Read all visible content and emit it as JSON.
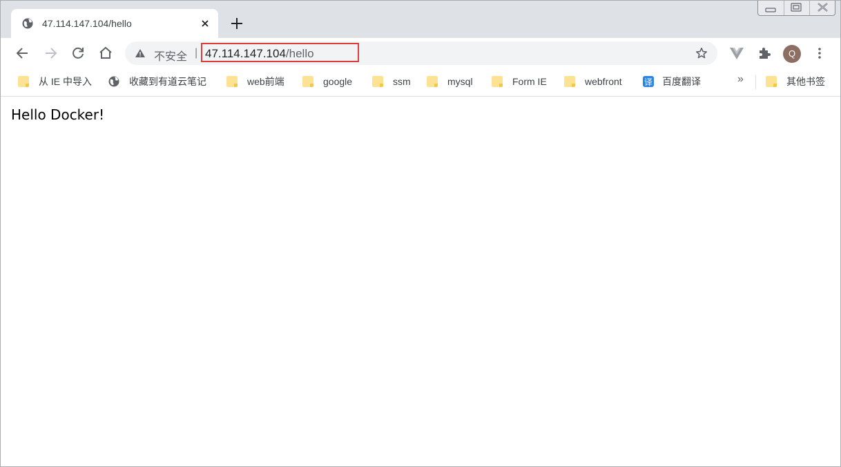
{
  "tab": {
    "title": "47.114.147.104/hello",
    "favicon_icon": "globe-icon"
  },
  "omnibox": {
    "security_label": "不安全",
    "separator": "|",
    "url_host": "47.114.147.104",
    "url_path": "/hello"
  },
  "avatar": {
    "initial": "Q"
  },
  "bookmarks": {
    "items": [
      {
        "label": "从 IE 中导入",
        "icon": "folder-icon"
      },
      {
        "label": "收藏到有道云笔记",
        "icon": "globe-icon"
      },
      {
        "label": "web前端",
        "icon": "folder-icon"
      },
      {
        "label": "google",
        "icon": "folder-icon"
      },
      {
        "label": "ssm",
        "icon": "folder-icon"
      },
      {
        "label": "mysql",
        "icon": "folder-icon"
      },
      {
        "label": "Form IE",
        "icon": "folder-icon"
      },
      {
        "label": "webfront",
        "icon": "folder-icon"
      },
      {
        "label": "百度翻译",
        "icon": "translate-icon",
        "icon_text": "译"
      }
    ],
    "overflow": "»",
    "other_label": "其他书签"
  },
  "page": {
    "text": "Hello Docker!"
  },
  "colors": {
    "highlight": "#e03b3b",
    "tabstrip": "#dee1e6",
    "folder": "#fde293"
  }
}
